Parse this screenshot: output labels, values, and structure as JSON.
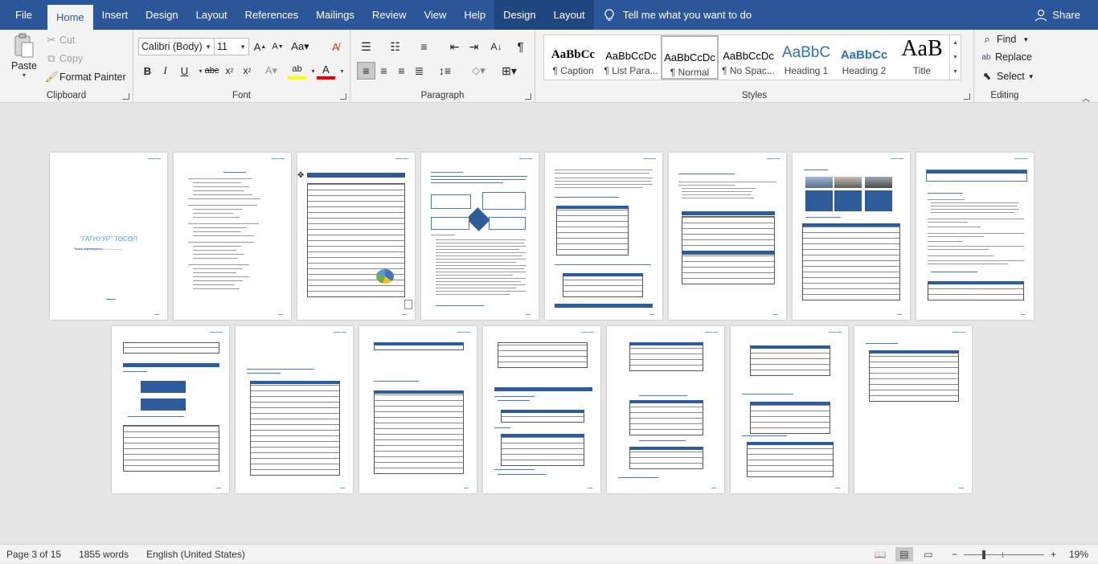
{
  "tabs": {
    "file": "File",
    "home": "Home",
    "insert": "Insert",
    "design": "Design",
    "layout": "Layout",
    "references": "References",
    "mailings": "Mailings",
    "review": "Review",
    "view": "View",
    "help": "Help",
    "table_design": "Design",
    "table_layout": "Layout",
    "tell_me": "Tell me what you want to do",
    "share": "Share"
  },
  "clipboard": {
    "label": "Clipboard",
    "paste": "Paste",
    "cut": "Cut",
    "copy": "Copy",
    "format_painter": "Format Painter"
  },
  "font": {
    "label": "Font",
    "name": "Calibri (Body)",
    "size": "11"
  },
  "paragraph": {
    "label": "Paragraph"
  },
  "styles": {
    "label": "Styles",
    "items": [
      {
        "sample": "AaBbCc",
        "name": "¶ Caption"
      },
      {
        "sample": "AaBbCcDc",
        "name": "¶ List Para..."
      },
      {
        "sample": "AaBbCcDc",
        "name": "¶ Normal"
      },
      {
        "sample": "AaBbCcDc",
        "name": "¶ No Spac..."
      },
      {
        "sample": "AaBbC",
        "name": "Heading 1"
      },
      {
        "sample": "AaBbCc",
        "name": "Heading 2"
      },
      {
        "sample": "AaB",
        "name": "Title"
      }
    ]
  },
  "editing": {
    "label": "Editing",
    "find": "Find",
    "replace": "Replace",
    "select": "Select"
  },
  "document": {
    "cover_title": "\"ГАГНУУР\" ТӨСӨЛ",
    "cover_subtitle": "Төсөл хэрэгжүүлэгч:........................"
  },
  "status": {
    "page": "Page 3 of 15",
    "words": "1855 words",
    "language": "English (United States)",
    "zoom": "19%"
  },
  "colors": {
    "brand": "#2b579a",
    "ribbon": "#f3f3f3",
    "canvas": "#e6e6e6"
  }
}
